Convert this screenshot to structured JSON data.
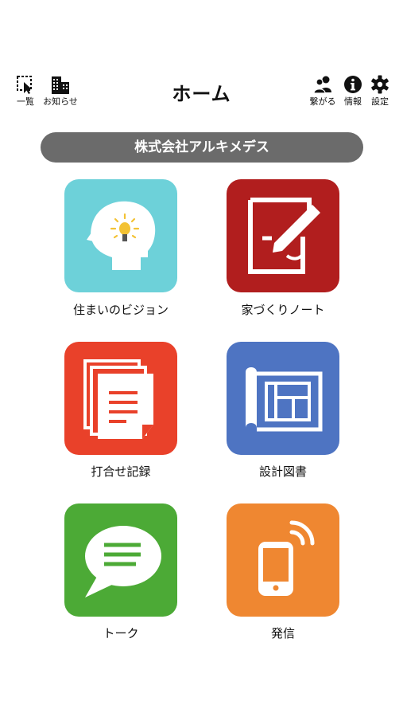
{
  "header": {
    "title": "ホーム",
    "left_buttons": [
      {
        "label": "一覧",
        "icon": "select-cursor-icon"
      },
      {
        "label": "お知らせ",
        "icon": "building-icon"
      }
    ],
    "right_buttons": [
      {
        "label": "繋がる",
        "icon": "users-icon"
      },
      {
        "label": "情報",
        "icon": "info-icon"
      },
      {
        "label": "設定",
        "icon": "gear-icon"
      }
    ]
  },
  "company": {
    "name": "株式会社アルキメデス"
  },
  "menu": [
    {
      "label": "住まいのビジョン",
      "color": "#6dd1d9",
      "icon": "head-lightbulb-icon"
    },
    {
      "label": "家づくりノート",
      "color": "#b11e1e",
      "icon": "note-pen-icon"
    },
    {
      "label": "打合せ記録",
      "color": "#e9412a",
      "icon": "documents-stack-icon"
    },
    {
      "label": "設計図書",
      "color": "#4e74c2",
      "icon": "blueprint-icon"
    },
    {
      "label": "トーク",
      "color": "#4caa36",
      "icon": "chat-bubble-icon"
    },
    {
      "label": "発信",
      "color": "#ef8731",
      "icon": "phone-signal-icon"
    }
  ]
}
